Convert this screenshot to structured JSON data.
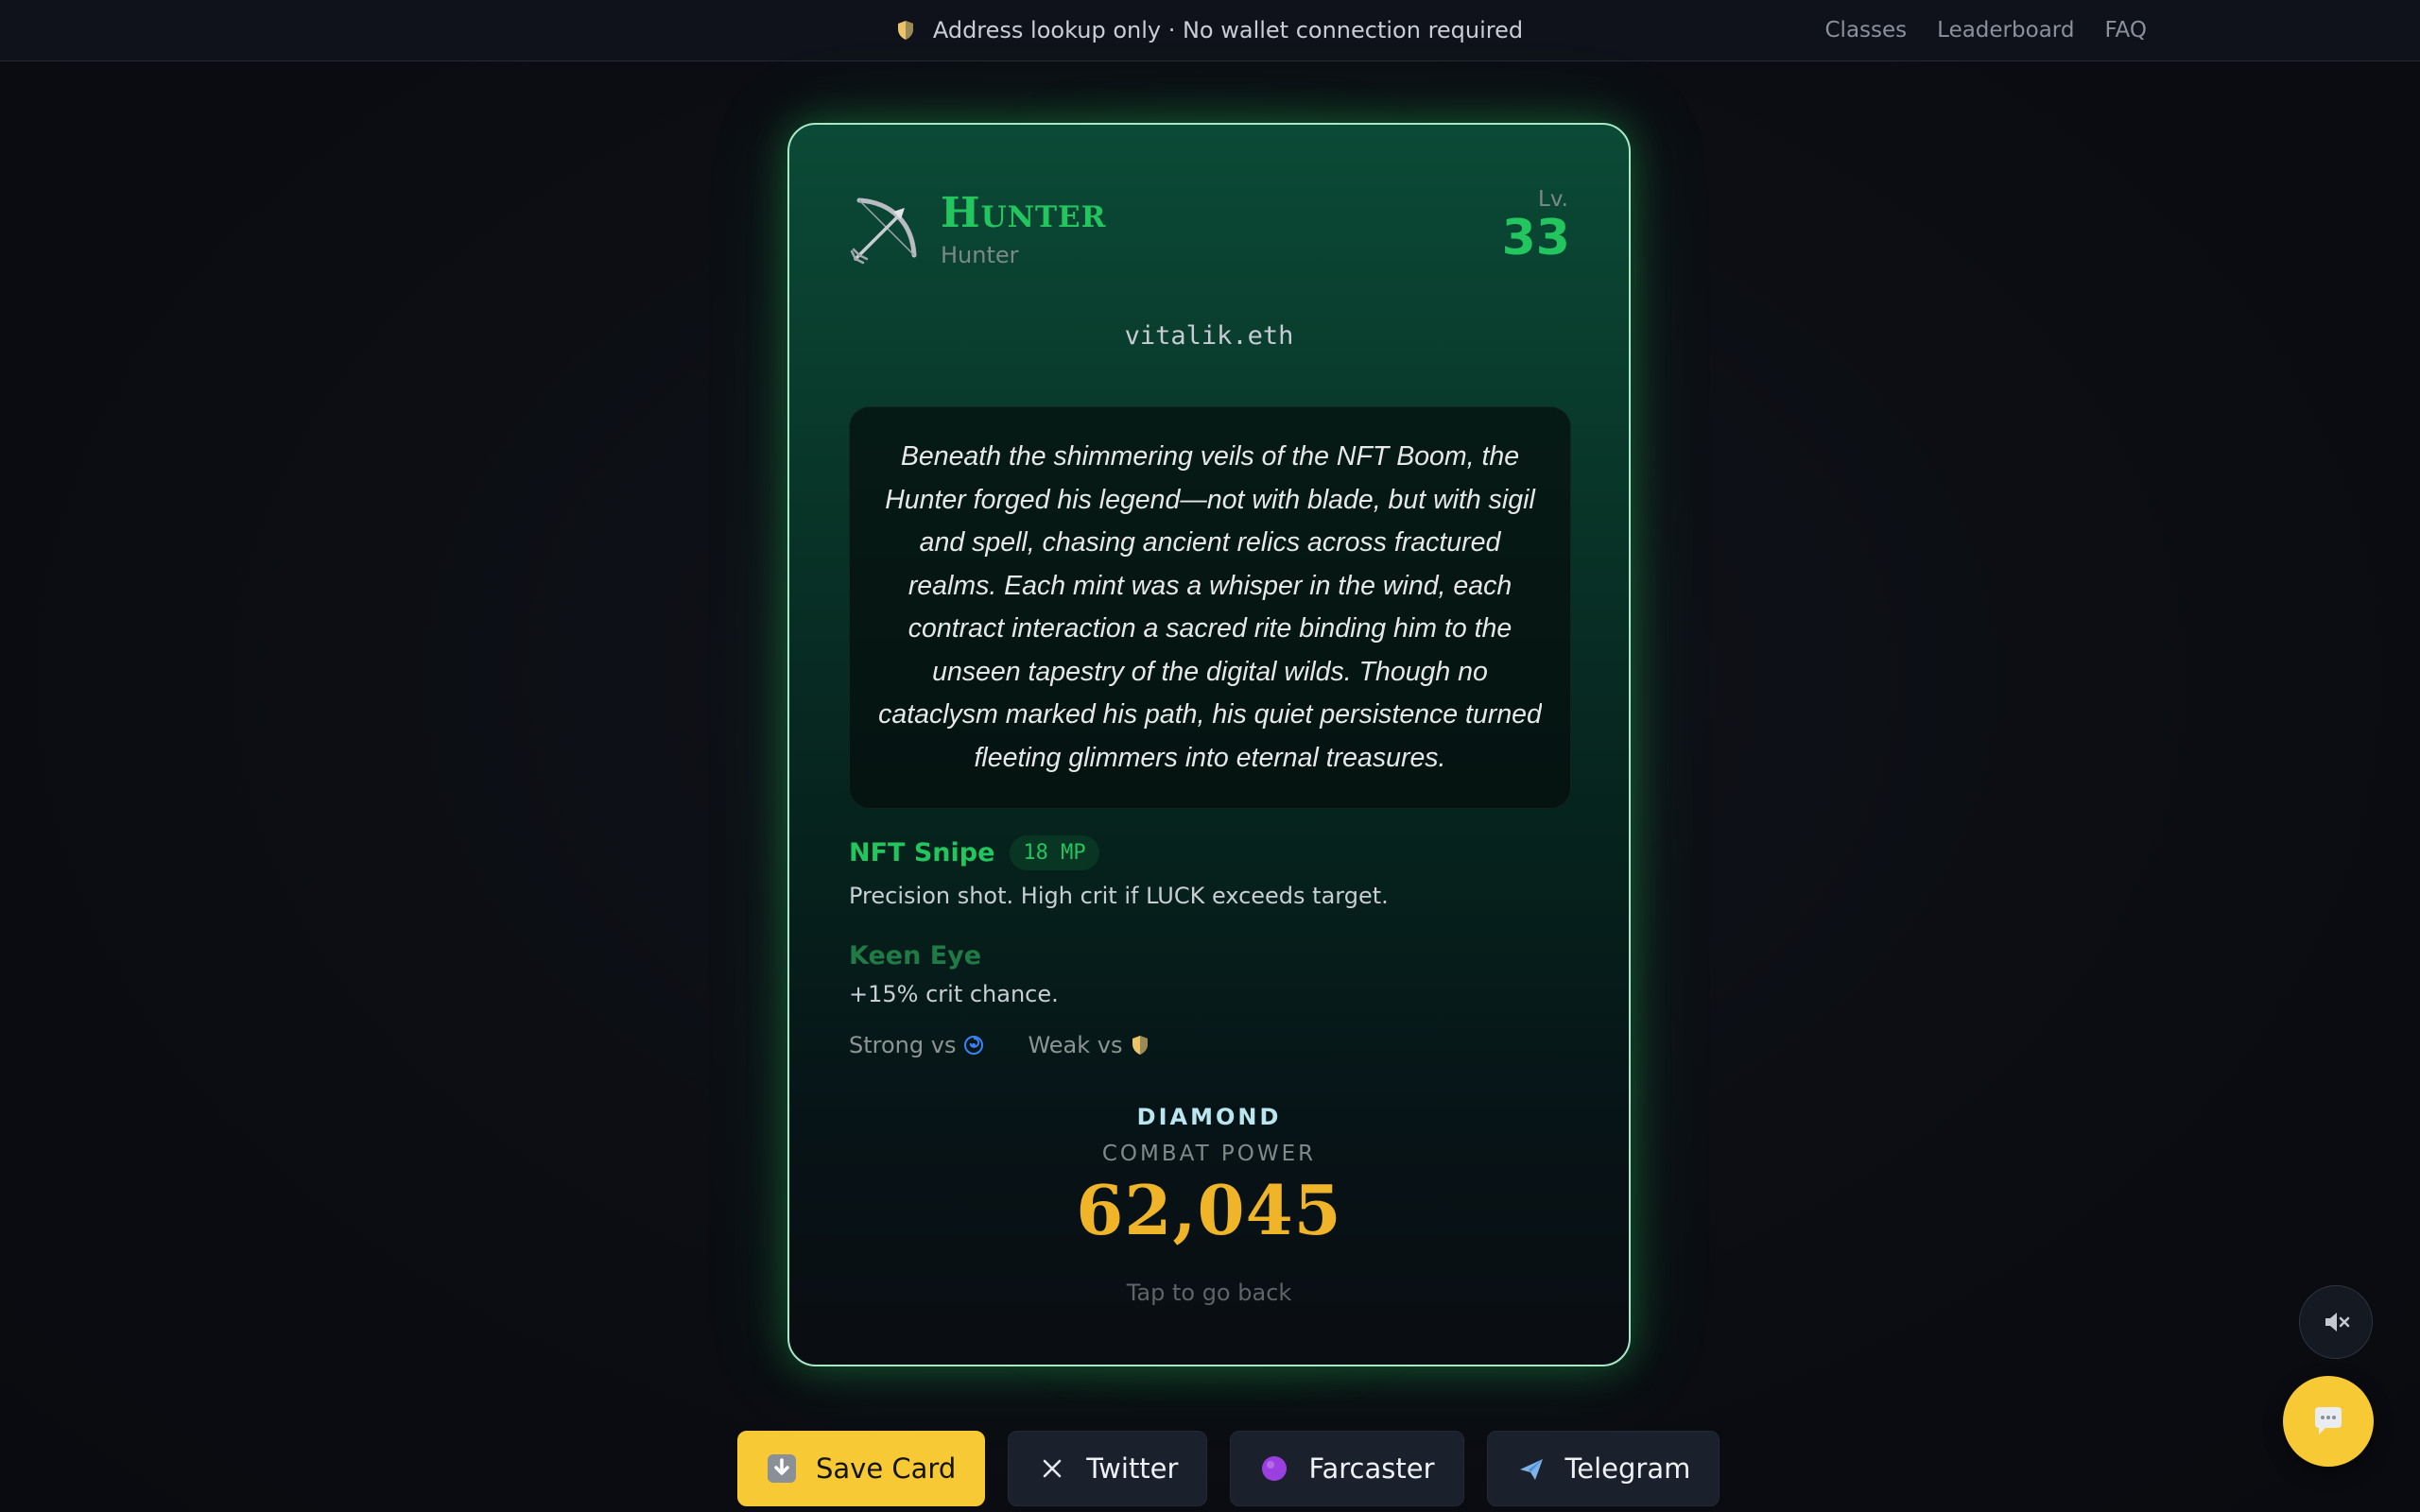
{
  "topbar": {
    "notice_icon": "shield-icon",
    "notice": "Address lookup only · No wallet connection required",
    "nav": [
      "Classes",
      "Leaderboard",
      "FAQ"
    ]
  },
  "card": {
    "class_icon": "bow-and-arrow-icon",
    "class_title": "Hunter",
    "class_subtitle": "Hunter",
    "level_label": "Lv.",
    "level": "33",
    "address": "vitalik.eth",
    "lore": "Beneath the shimmering veils of the NFT Boom, the Hunter forged his legend—not with blade, but with sigil and spell, chasing ancient relics across fractured realms. Each mint was a whisper in the wind, each contract interaction a sacred rite binding him to the unseen tapestry of the digital wilds. Though no cataclysm marked his path, his quiet persistence turned fleeting glimmers into eternal treasures.",
    "skill": {
      "name": "NFT Snipe",
      "cost": "18 MP",
      "description": "Precision shot. High crit if LUCK exceeds target."
    },
    "passive": {
      "name": "Keen Eye",
      "description": "+15% crit chance."
    },
    "matchups": {
      "strong_label": "Strong vs",
      "strong_icon": "cyclone-icon",
      "weak_label": "Weak vs",
      "weak_icon": "shield-icon"
    },
    "tier": "DIAMOND",
    "combat_power_label": "COMBAT POWER",
    "combat_power": "62,045",
    "back_hint": "Tap to go back"
  },
  "share": {
    "save_label": "Save Card",
    "twitter_label": "Twitter",
    "farcaster_label": "Farcaster",
    "telegram_label": "Telegram"
  },
  "colors": {
    "accent_green": "#22c55e",
    "gold": "#f0b429",
    "button_yellow": "#f6c935"
  }
}
